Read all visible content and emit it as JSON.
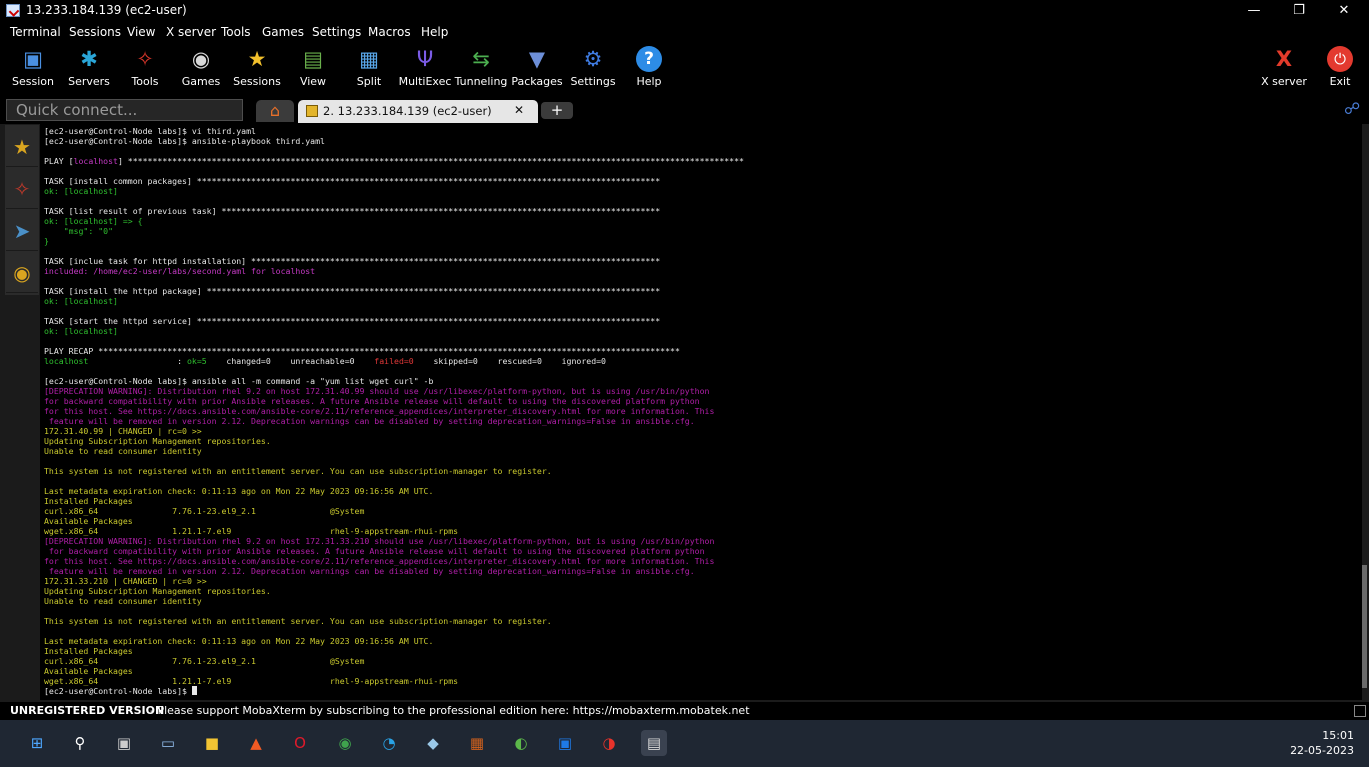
{
  "window": {
    "title": "13.233.184.139 (ec2-user)",
    "minimize": "—",
    "maximize": "❐",
    "close": "✕"
  },
  "menu": [
    "Terminal",
    "Sessions",
    "View",
    "X server",
    "Tools",
    "Games",
    "Settings",
    "Macros",
    "Help"
  ],
  "toolbar": {
    "left": [
      {
        "label": "Session",
        "icon": "session-icon"
      },
      {
        "label": "Servers",
        "icon": "servers-icon"
      },
      {
        "label": "Tools",
        "icon": "tools-icon"
      },
      {
        "label": "Games",
        "icon": "games-icon"
      },
      {
        "label": "Sessions",
        "icon": "star-icon"
      },
      {
        "label": "View",
        "icon": "view-icon"
      },
      {
        "label": "Split",
        "icon": "split-icon"
      },
      {
        "label": "MultiExec",
        "icon": "multiexec-icon"
      },
      {
        "label": "Tunneling",
        "icon": "tunneling-icon"
      },
      {
        "label": "Packages",
        "icon": "packages-icon"
      },
      {
        "label": "Settings",
        "icon": "settings-icon"
      },
      {
        "label": "Help",
        "icon": "help-icon"
      }
    ],
    "right": [
      {
        "label": "X server",
        "icon": "x-server-icon"
      },
      {
        "label": "Exit",
        "icon": "power-icon"
      }
    ]
  },
  "quick_connect": {
    "placeholder": "Quick connect..."
  },
  "tabs": {
    "active_label": "2. 13.233.184.139 (ec2-user)",
    "close": "✕",
    "new": "+"
  },
  "terminal": {
    "lines": [
      [
        {
          "t": "[ec2-user@Control-Node labs]$ vi third.yaml",
          "c": "w"
        }
      ],
      [
        {
          "t": "[ec2-user@Control-Node labs]$ ansible-playbook third.yaml",
          "c": "w"
        }
      ],
      [
        {
          "t": "",
          "c": "w"
        }
      ],
      [
        {
          "t": "PLAY [",
          "c": "w"
        },
        {
          "t": "localhost",
          "c": "m"
        },
        {
          "t": "] *****************************************************************************************************************************",
          "c": "w"
        }
      ],
      [
        {
          "t": "",
          "c": "w"
        }
      ],
      [
        {
          "t": "TASK [install common packages] **********************************************************************************************",
          "c": "w"
        }
      ],
      [
        {
          "t": "ok: [localhost]",
          "c": "g"
        }
      ],
      [
        {
          "t": "",
          "c": "w"
        }
      ],
      [
        {
          "t": "TASK [list result of previous task] *****************************************************************************************",
          "c": "w"
        }
      ],
      [
        {
          "t": "ok: [localhost] => {",
          "c": "g"
        }
      ],
      [
        {
          "t": "    \"msg\": \"0\"",
          "c": "g"
        }
      ],
      [
        {
          "t": "}",
          "c": "g"
        }
      ],
      [
        {
          "t": "",
          "c": "w"
        }
      ],
      [
        {
          "t": "TASK [inclue task for httpd installation] ***********************************************************************************",
          "c": "w"
        }
      ],
      [
        {
          "t": "included: /home/ec2-user/labs/second.yaml for localhost",
          "c": "m"
        }
      ],
      [
        {
          "t": "",
          "c": "w"
        }
      ],
      [
        {
          "t": "TASK [install the httpd package] ********************************************************************************************",
          "c": "w"
        }
      ],
      [
        {
          "t": "ok: [localhost]",
          "c": "g"
        }
      ],
      [
        {
          "t": "",
          "c": "w"
        }
      ],
      [
        {
          "t": "TASK [start the httpd service] **********************************************************************************************",
          "c": "w"
        }
      ],
      [
        {
          "t": "ok: [localhost]",
          "c": "g"
        }
      ],
      [
        {
          "t": "",
          "c": "w"
        }
      ],
      [
        {
          "t": "PLAY RECAP **********************************************************************************************************************",
          "c": "w"
        }
      ],
      [
        {
          "t": "localhost",
          "c": "g"
        },
        {
          "t": "                  : ",
          "c": "w"
        },
        {
          "t": "ok=5",
          "c": "g"
        },
        {
          "t": "    changed=0    unreachable=0    ",
          "c": "w"
        },
        {
          "t": "failed=0",
          "c": "r"
        },
        {
          "t": "    skipped=0    rescued=0    ignored=0",
          "c": "w"
        }
      ],
      [
        {
          "t": "",
          "c": "w"
        }
      ],
      [
        {
          "t": "[ec2-user@Control-Node labs]$ ansible all -m command -a \"yum list wget curl\" -b",
          "c": "w"
        }
      ],
      [
        {
          "t": "[DEPRECATION WARNING]: Distribution rhel 9.2 on host 172.31.40.99 should use /usr/libexec/platform-python, but is using /usr/bin/python",
          "c": "c"
        }
      ],
      [
        {
          "t": "for backward compatibility with prior Ansible releases. A future Ansible release will default to using the discovered platform python",
          "c": "c"
        }
      ],
      [
        {
          "t": "for this host. See https://docs.ansible.com/ansible-core/2.11/reference_appendices/interpreter_discovery.html for more information. This",
          "c": "c"
        }
      ],
      [
        {
          "t": " feature will be removed in version 2.12. Deprecation warnings can be disabled by setting deprecation_warnings=False in ansible.cfg.",
          "c": "c"
        }
      ],
      [
        {
          "t": "172.31.40.99 | CHANGED | rc=0 >>",
          "c": "y"
        }
      ],
      [
        {
          "t": "Updating Subscription Management repositories.",
          "c": "y"
        }
      ],
      [
        {
          "t": "Unable to read consumer identity",
          "c": "y"
        }
      ],
      [
        {
          "t": "",
          "c": "w"
        }
      ],
      [
        {
          "t": "This system is not registered with an entitlement server. You can use subscription-manager to register.",
          "c": "y"
        }
      ],
      [
        {
          "t": "",
          "c": "w"
        }
      ],
      [
        {
          "t": "Last metadata expiration check: 0:11:13 ago on Mon 22 May 2023 09:16:56 AM UTC.",
          "c": "y"
        }
      ],
      [
        {
          "t": "Installed Packages",
          "c": "y"
        }
      ],
      [
        {
          "t": "curl.x86_64               7.76.1-23.el9_2.1               @System",
          "c": "y"
        }
      ],
      [
        {
          "t": "Available Packages",
          "c": "y"
        }
      ],
      [
        {
          "t": "wget.x86_64               1.21.1-7.el9                    rhel-9-appstream-rhui-rpms",
          "c": "y"
        }
      ],
      [
        {
          "t": "[DEPRECATION WARNING]: Distribution rhel 9.2 on host 172.31.33.210 should use /usr/libexec/platform-python, but is using /usr/bin/python",
          "c": "c"
        }
      ],
      [
        {
          "t": " for backward compatibility with prior Ansible releases. A future Ansible release will default to using the discovered platform python",
          "c": "c"
        }
      ],
      [
        {
          "t": "for this host. See https://docs.ansible.com/ansible-core/2.11/reference_appendices/interpreter_discovery.html for more information. This",
          "c": "c"
        }
      ],
      [
        {
          "t": " feature will be removed in version 2.12. Deprecation warnings can be disabled by setting deprecation_warnings=False in ansible.cfg.",
          "c": "c"
        }
      ],
      [
        {
          "t": "172.31.33.210 | CHANGED | rc=0 >>",
          "c": "y"
        }
      ],
      [
        {
          "t": "Updating Subscription Management repositories.",
          "c": "y"
        }
      ],
      [
        {
          "t": "Unable to read consumer identity",
          "c": "y"
        }
      ],
      [
        {
          "t": "",
          "c": "w"
        }
      ],
      [
        {
          "t": "This system is not registered with an entitlement server. You can use subscription-manager to register.",
          "c": "y"
        }
      ],
      [
        {
          "t": "",
          "c": "w"
        }
      ],
      [
        {
          "t": "Last metadata expiration check: 0:11:13 ago on Mon 22 May 2023 09:16:56 AM UTC.",
          "c": "y"
        }
      ],
      [
        {
          "t": "Installed Packages",
          "c": "y"
        }
      ],
      [
        {
          "t": "curl.x86_64               7.76.1-23.el9_2.1               @System",
          "c": "y"
        }
      ],
      [
        {
          "t": "Available Packages",
          "c": "y"
        }
      ],
      [
        {
          "t": "wget.x86_64               1.21.1-7.el9                    rhel-9-appstream-rhui-rpms",
          "c": "y"
        }
      ],
      [
        {
          "t": "[ec2-user@Control-Node labs]$ ",
          "c": "w"
        }
      ]
    ]
  },
  "status": {
    "unregistered": "UNREGISTERED VERSION",
    "message": "-  Please support MobaXterm by subscribing to the professional edition here:  https://mobaxterm.mobatek.net"
  },
  "taskbar": {
    "items": [
      {
        "icon": "windows-start-icon",
        "glyph": "⊞",
        "color": "#4ea7ff"
      },
      {
        "icon": "search-icon",
        "glyph": "⚲",
        "color": "#ffffff"
      },
      {
        "icon": "task-view-icon",
        "glyph": "▣",
        "color": "#cccccc"
      },
      {
        "icon": "photos-icon",
        "glyph": "▭",
        "color": "#8fb8e6"
      },
      {
        "icon": "file-explorer-icon",
        "glyph": "■",
        "color": "#f2c433"
      },
      {
        "icon": "brave-icon",
        "glyph": "▲",
        "color": "#f05a24"
      },
      {
        "icon": "opera-icon",
        "glyph": "O",
        "color": "#e01a2b"
      },
      {
        "icon": "chrome-icon",
        "glyph": "◉",
        "color": "#3fa34d"
      },
      {
        "icon": "edge-icon",
        "glyph": "◔",
        "color": "#29a3e6"
      },
      {
        "icon": "notes-icon",
        "glyph": "◆",
        "color": "#9ac8e8"
      },
      {
        "icon": "media-app-icon",
        "glyph": "▦",
        "color": "#d0601c"
      },
      {
        "icon": "network-icon",
        "glyph": "◐",
        "color": "#5cb84a"
      },
      {
        "icon": "remote-app-icon",
        "glyph": "▣",
        "color": "#1e7ae6"
      },
      {
        "icon": "speed-app-icon",
        "glyph": "◑",
        "color": "#e8332b"
      },
      {
        "icon": "mobaxterm-icon",
        "glyph": "▤",
        "color": "#d8d8d8"
      }
    ],
    "time": "15:01",
    "date": "22-05-2023"
  },
  "colors": {
    "terminal_bg": "#000000",
    "ok_green": "#2fbf2f",
    "warning_magenta": "#b01fa8",
    "output_yellow": "#c9c92e",
    "failed_red": "#e03838"
  }
}
